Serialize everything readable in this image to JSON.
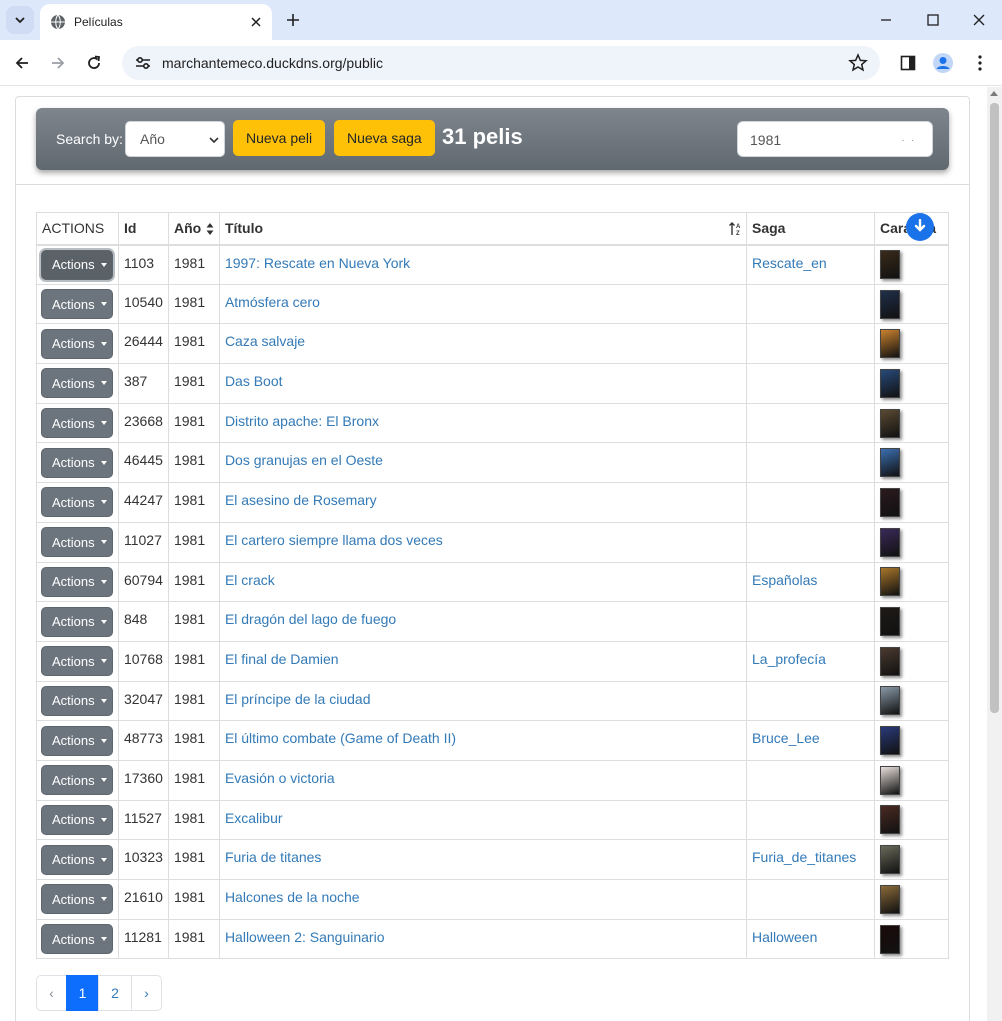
{
  "browser": {
    "tab_title": "Películas",
    "url": "marchantemeco.duckdns.org/public"
  },
  "searchbar": {
    "label": "Search by:",
    "select_value": "Año",
    "btn_new_movie": "Nueva peli",
    "btn_new_saga": "Nueva saga",
    "count": "31 pelis",
    "search_value": "1981",
    "search_dots": ". ."
  },
  "table": {
    "headers": [
      "ACTIONS",
      "Id",
      "Año",
      "Título",
      "Saga",
      "Carátula"
    ],
    "action_label": "Actions",
    "rows": [
      {
        "id": "1103",
        "year": "1981",
        "title": "1997: Rescate en Nueva York",
        "saga": "Rescate_en",
        "poster_color": "#3a2a1a"
      },
      {
        "id": "10540",
        "year": "1981",
        "title": "Atmósfera cero",
        "saga": "",
        "poster_color": "#1f2f4a"
      },
      {
        "id": "26444",
        "year": "1981",
        "title": "Caza salvaje",
        "saga": "",
        "poster_color": "#c9822f"
      },
      {
        "id": "387",
        "year": "1981",
        "title": "Das Boot",
        "saga": "",
        "poster_color": "#284a7a"
      },
      {
        "id": "23668",
        "year": "1981",
        "title": "Distrito apache: El Bronx",
        "saga": "",
        "poster_color": "#5a4a32"
      },
      {
        "id": "46445",
        "year": "1981",
        "title": "Dos granujas en el Oeste",
        "saga": "",
        "poster_color": "#3b6fb0"
      },
      {
        "id": "44247",
        "year": "1981",
        "title": "El asesino de Rosemary",
        "saga": "",
        "poster_color": "#2a1a1e"
      },
      {
        "id": "11027",
        "year": "1981",
        "title": "El cartero siempre llama dos veces",
        "saga": "",
        "poster_color": "#3a2a5a"
      },
      {
        "id": "60794",
        "year": "1981",
        "title": "El crack",
        "saga": "Españolas",
        "poster_color": "#a8762a"
      },
      {
        "id": "848",
        "year": "1981",
        "title": "El dragón del lago de fuego",
        "saga": "",
        "poster_color": "#1e1a18"
      },
      {
        "id": "10768",
        "year": "1981",
        "title": "El final de Damien",
        "saga": "La_profecía",
        "poster_color": "#4a3a30"
      },
      {
        "id": "32047",
        "year": "1981",
        "title": "El príncipe de la ciudad",
        "saga": "",
        "poster_color": "#8a9aa8"
      },
      {
        "id": "48773",
        "year": "1981",
        "title": "El último combate (Game of Death II)",
        "saga": "Bruce_Lee",
        "poster_color": "#2a3a7a"
      },
      {
        "id": "17360",
        "year": "1981",
        "title": "Evasión o victoria",
        "saga": "",
        "poster_color": "#e8e0dc"
      },
      {
        "id": "11527",
        "year": "1981",
        "title": "Excalibur",
        "saga": "",
        "poster_color": "#4a2a22"
      },
      {
        "id": "10323",
        "year": "1981",
        "title": "Furia de titanes",
        "saga": "Furia_de_titanes",
        "poster_color": "#6a6a5a"
      },
      {
        "id": "21610",
        "year": "1981",
        "title": "Halcones de la noche",
        "saga": "",
        "poster_color": "#8a6a3a"
      },
      {
        "id": "11281",
        "year": "1981",
        "title": "Halloween 2: Sanguinario",
        "saga": "Halloween",
        "poster_color": "#1a0a0a"
      }
    ]
  },
  "pagination": {
    "prev": "‹",
    "pages": [
      "1",
      "2"
    ],
    "next": "›",
    "active": "1"
  },
  "colors": {
    "link": "#337ab7",
    "accent_yellow": "#ffc107",
    "action_button": "#6c757d",
    "active_page": "#0d6efd"
  }
}
